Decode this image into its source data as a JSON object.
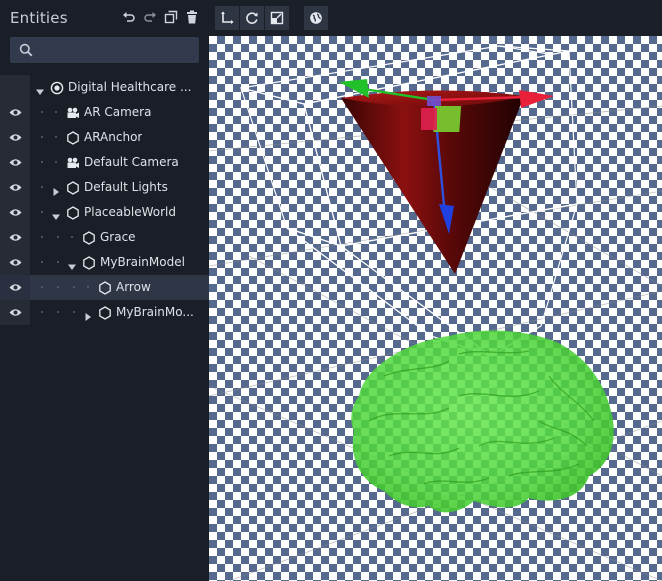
{
  "sidebar": {
    "title": "Entities",
    "tools": [
      {
        "name": "undo-icon"
      },
      {
        "name": "redo-icon"
      },
      {
        "name": "duplicate-icon"
      },
      {
        "name": "delete-icon"
      }
    ],
    "search": {
      "value": "",
      "placeholder": ""
    }
  },
  "tree": [
    {
      "label": "Digital Healthcare ...",
      "icon": "target-icon",
      "depth": 0,
      "expand": "expanded",
      "eye": false,
      "selected": false
    },
    {
      "label": "AR Camera",
      "icon": "camera-icon",
      "depth": 1,
      "expand": "none",
      "eye": true,
      "selected": false
    },
    {
      "label": "ARAnchor",
      "icon": "hexagon-icon",
      "depth": 1,
      "expand": "none",
      "eye": true,
      "selected": false
    },
    {
      "label": "Default Camera",
      "icon": "camera-icon",
      "depth": 1,
      "expand": "none",
      "eye": true,
      "selected": false
    },
    {
      "label": "Default Lights",
      "icon": "hexagon-icon",
      "depth": 1,
      "expand": "collapsed",
      "eye": true,
      "selected": false
    },
    {
      "label": "PlaceableWorld",
      "icon": "hexagon-icon",
      "depth": 1,
      "expand": "expanded",
      "eye": true,
      "selected": false
    },
    {
      "label": "Grace",
      "icon": "hexagon-icon",
      "depth": 2,
      "expand": "none",
      "eye": true,
      "selected": false
    },
    {
      "label": "MyBrainModel",
      "icon": "hexagon-icon",
      "depth": 2,
      "expand": "expanded",
      "eye": true,
      "selected": false
    },
    {
      "label": "Arrow",
      "icon": "hexagon-icon",
      "depth": 3,
      "expand": "none",
      "eye": true,
      "selected": true
    },
    {
      "label": "MyBrainMo...",
      "icon": "hexagon-icon",
      "depth": 3,
      "expand": "collapsed",
      "eye": true,
      "selected": false
    }
  ],
  "toolbar": {
    "tools": [
      {
        "name": "move-tool-icon",
        "active": true
      },
      {
        "name": "rotate-tool-icon",
        "active": false
      },
      {
        "name": "scale-tool-icon",
        "active": false
      },
      {
        "name": "world-space-icon",
        "active": false
      }
    ]
  },
  "colors": {
    "panel": "#1a1e27",
    "checker_dark": "#56698f",
    "cone": "#8b1010",
    "brain": "#4fe03a",
    "gizmo_red": "#e8203a",
    "gizmo_green": "#22c02a",
    "gizmo_blue": "#2040e0"
  }
}
